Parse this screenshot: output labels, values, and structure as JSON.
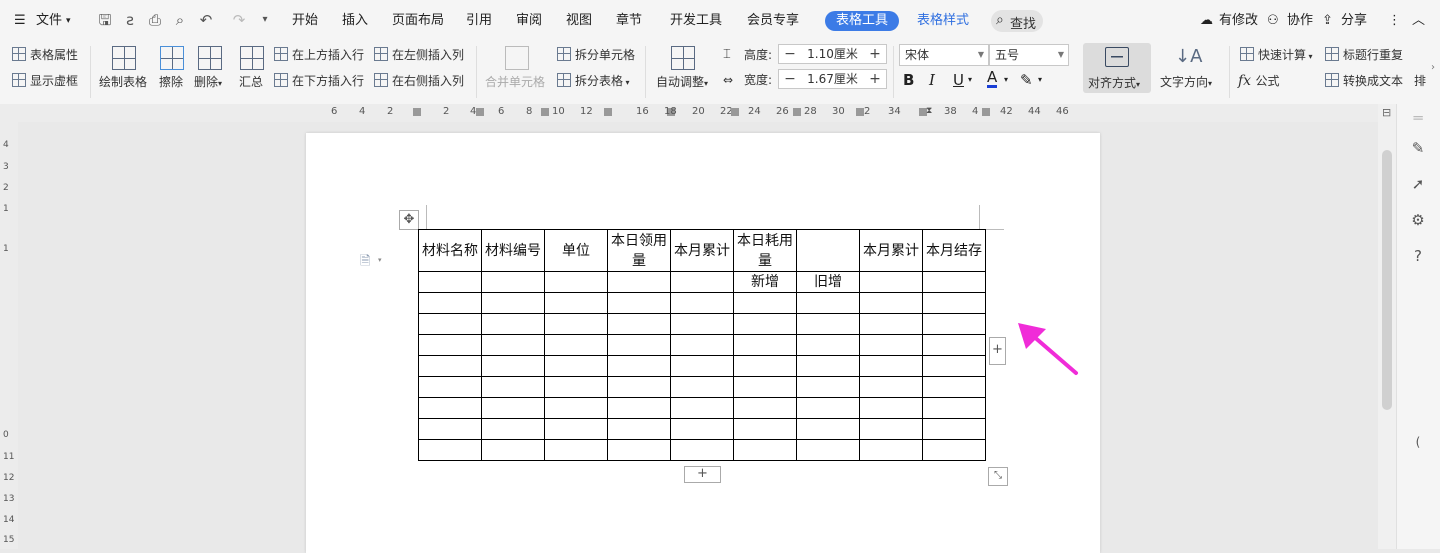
{
  "menubar": {
    "file_label": "文件",
    "tabs": [
      "开始",
      "插入",
      "页面布局",
      "引用",
      "审阅",
      "视图",
      "章节",
      "开发工具",
      "会员专享"
    ],
    "active_tab": "表格工具",
    "style_tab": "表格样式",
    "search_label": "查找",
    "right": {
      "modified": "有修改",
      "collab": "协作",
      "share": "分享"
    }
  },
  "ribbon": {
    "table_props": "表格属性",
    "show_grid": "显示虚框",
    "draw_table": "绘制表格",
    "erase": "擦除",
    "delete": "删除",
    "summary": "汇总",
    "insert_row_above": "在上方插入行",
    "insert_row_below": "在下方插入行",
    "insert_col_left": "在左侧插入列",
    "insert_col_right": "在右侧插入列",
    "merge_cells": "合并单元格",
    "split_cells": "拆分单元格",
    "split_table": "拆分表格",
    "auto_fit": "自动调整",
    "height_label": "高度:",
    "height_value": "1.10厘米",
    "width_label": "宽度:",
    "width_value": "1.67厘米",
    "font_name": "宋体",
    "font_size": "五号",
    "align": "对齐方式",
    "text_dir": "文字方向",
    "quick_calc": "快速计算",
    "formula": "公式",
    "header_repeat": "标题行重复",
    "to_text": "转换成文本",
    "sort_short": "排"
  },
  "ruler": {
    "numbers": [
      "6",
      "4",
      "2",
      "2",
      "4",
      "6",
      "8",
      "10",
      "12",
      "16",
      "18",
      "20",
      "22",
      "24",
      "26",
      "28",
      "30",
      "2",
      "34",
      "38",
      "4",
      "42",
      "44",
      "46"
    ],
    "vnumbers": [
      "4",
      "3",
      "2",
      "1",
      "1",
      "0",
      "11",
      "12",
      "13",
      "14",
      "15"
    ]
  },
  "table": {
    "header": [
      "材料名称",
      "材料编号",
      "单位",
      "本日领用量",
      "本月累计",
      "本日耗用量",
      "",
      "本月累计",
      "本月结存"
    ],
    "sub_header": [
      "",
      "",
      "",
      "",
      "",
      "新增",
      "旧增",
      "",
      ""
    ],
    "empty_rows": 8
  },
  "colors": {
    "accent": "#3c7be6",
    "arrow": "#f02cd8"
  }
}
